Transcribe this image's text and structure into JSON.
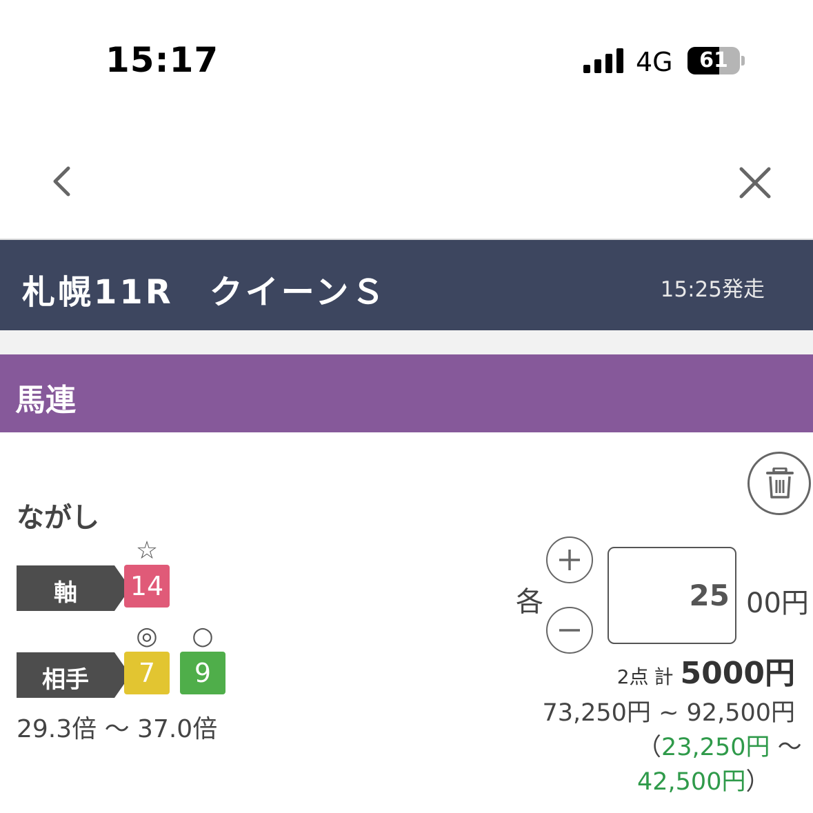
{
  "status_bar": {
    "time": "15:17",
    "network": "4G",
    "battery": "61",
    "battery_level": 0.61
  },
  "race": {
    "title": "札幌11R　クイーンＳ",
    "post_time": "15:25発走"
  },
  "bet": {
    "type": "馬連",
    "method": "ながし",
    "axis": {
      "label": "軸",
      "horses": [
        {
          "number": "14",
          "mark": "☆",
          "color": "#e05a78"
        }
      ]
    },
    "partners": {
      "label": "相手",
      "horses": [
        {
          "number": "7",
          "mark": "◎",
          "color": "#e2c531"
        },
        {
          "number": "9",
          "mark": "○",
          "color": "#4fae4a"
        }
      ]
    },
    "odds_range": "29.3倍 〜 37.0倍",
    "each_label": "各",
    "amount": "25",
    "amount_unit": "00円",
    "count": "2点",
    "total_key": "計",
    "total_amount": "5000円",
    "payout_range": "73,250円 ~ 92,500円",
    "profit_open": "（",
    "profit_min": "23,250円",
    "profit_sep": " 〜",
    "profit_max": "42,500円",
    "profit_close": "）"
  },
  "icons": {
    "back": "chevron-left-icon",
    "close": "close-icon",
    "trash": "trash-icon",
    "plus": "plus-icon",
    "minus": "minus-icon"
  }
}
